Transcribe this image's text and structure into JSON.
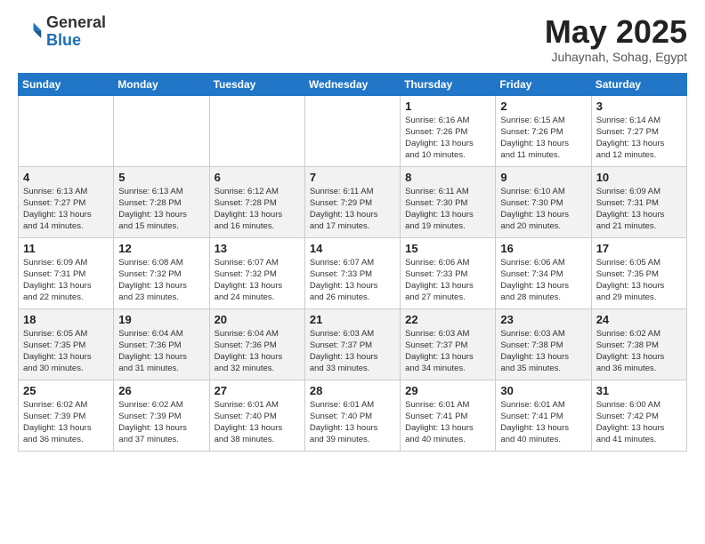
{
  "header": {
    "logo_general": "General",
    "logo_blue": "Blue",
    "title": "May 2025",
    "subtitle": "Juhaynah, Sohag, Egypt"
  },
  "calendar": {
    "days_of_week": [
      "Sunday",
      "Monday",
      "Tuesday",
      "Wednesday",
      "Thursday",
      "Friday",
      "Saturday"
    ],
    "weeks": [
      [
        {
          "day": "",
          "info": ""
        },
        {
          "day": "",
          "info": ""
        },
        {
          "day": "",
          "info": ""
        },
        {
          "day": "",
          "info": ""
        },
        {
          "day": "1",
          "info": "Sunrise: 6:16 AM\nSunset: 7:26 PM\nDaylight: 13 hours\nand 10 minutes."
        },
        {
          "day": "2",
          "info": "Sunrise: 6:15 AM\nSunset: 7:26 PM\nDaylight: 13 hours\nand 11 minutes."
        },
        {
          "day": "3",
          "info": "Sunrise: 6:14 AM\nSunset: 7:27 PM\nDaylight: 13 hours\nand 12 minutes."
        }
      ],
      [
        {
          "day": "4",
          "info": "Sunrise: 6:13 AM\nSunset: 7:27 PM\nDaylight: 13 hours\nand 14 minutes."
        },
        {
          "day": "5",
          "info": "Sunrise: 6:13 AM\nSunset: 7:28 PM\nDaylight: 13 hours\nand 15 minutes."
        },
        {
          "day": "6",
          "info": "Sunrise: 6:12 AM\nSunset: 7:28 PM\nDaylight: 13 hours\nand 16 minutes."
        },
        {
          "day": "7",
          "info": "Sunrise: 6:11 AM\nSunset: 7:29 PM\nDaylight: 13 hours\nand 17 minutes."
        },
        {
          "day": "8",
          "info": "Sunrise: 6:11 AM\nSunset: 7:30 PM\nDaylight: 13 hours\nand 19 minutes."
        },
        {
          "day": "9",
          "info": "Sunrise: 6:10 AM\nSunset: 7:30 PM\nDaylight: 13 hours\nand 20 minutes."
        },
        {
          "day": "10",
          "info": "Sunrise: 6:09 AM\nSunset: 7:31 PM\nDaylight: 13 hours\nand 21 minutes."
        }
      ],
      [
        {
          "day": "11",
          "info": "Sunrise: 6:09 AM\nSunset: 7:31 PM\nDaylight: 13 hours\nand 22 minutes."
        },
        {
          "day": "12",
          "info": "Sunrise: 6:08 AM\nSunset: 7:32 PM\nDaylight: 13 hours\nand 23 minutes."
        },
        {
          "day": "13",
          "info": "Sunrise: 6:07 AM\nSunset: 7:32 PM\nDaylight: 13 hours\nand 24 minutes."
        },
        {
          "day": "14",
          "info": "Sunrise: 6:07 AM\nSunset: 7:33 PM\nDaylight: 13 hours\nand 26 minutes."
        },
        {
          "day": "15",
          "info": "Sunrise: 6:06 AM\nSunset: 7:33 PM\nDaylight: 13 hours\nand 27 minutes."
        },
        {
          "day": "16",
          "info": "Sunrise: 6:06 AM\nSunset: 7:34 PM\nDaylight: 13 hours\nand 28 minutes."
        },
        {
          "day": "17",
          "info": "Sunrise: 6:05 AM\nSunset: 7:35 PM\nDaylight: 13 hours\nand 29 minutes."
        }
      ],
      [
        {
          "day": "18",
          "info": "Sunrise: 6:05 AM\nSunset: 7:35 PM\nDaylight: 13 hours\nand 30 minutes."
        },
        {
          "day": "19",
          "info": "Sunrise: 6:04 AM\nSunset: 7:36 PM\nDaylight: 13 hours\nand 31 minutes."
        },
        {
          "day": "20",
          "info": "Sunrise: 6:04 AM\nSunset: 7:36 PM\nDaylight: 13 hours\nand 32 minutes."
        },
        {
          "day": "21",
          "info": "Sunrise: 6:03 AM\nSunset: 7:37 PM\nDaylight: 13 hours\nand 33 minutes."
        },
        {
          "day": "22",
          "info": "Sunrise: 6:03 AM\nSunset: 7:37 PM\nDaylight: 13 hours\nand 34 minutes."
        },
        {
          "day": "23",
          "info": "Sunrise: 6:03 AM\nSunset: 7:38 PM\nDaylight: 13 hours\nand 35 minutes."
        },
        {
          "day": "24",
          "info": "Sunrise: 6:02 AM\nSunset: 7:38 PM\nDaylight: 13 hours\nand 36 minutes."
        }
      ],
      [
        {
          "day": "25",
          "info": "Sunrise: 6:02 AM\nSunset: 7:39 PM\nDaylight: 13 hours\nand 36 minutes."
        },
        {
          "day": "26",
          "info": "Sunrise: 6:02 AM\nSunset: 7:39 PM\nDaylight: 13 hours\nand 37 minutes."
        },
        {
          "day": "27",
          "info": "Sunrise: 6:01 AM\nSunset: 7:40 PM\nDaylight: 13 hours\nand 38 minutes."
        },
        {
          "day": "28",
          "info": "Sunrise: 6:01 AM\nSunset: 7:40 PM\nDaylight: 13 hours\nand 39 minutes."
        },
        {
          "day": "29",
          "info": "Sunrise: 6:01 AM\nSunset: 7:41 PM\nDaylight: 13 hours\nand 40 minutes."
        },
        {
          "day": "30",
          "info": "Sunrise: 6:01 AM\nSunset: 7:41 PM\nDaylight: 13 hours\nand 40 minutes."
        },
        {
          "day": "31",
          "info": "Sunrise: 6:00 AM\nSunset: 7:42 PM\nDaylight: 13 hours\nand 41 minutes."
        }
      ]
    ]
  }
}
